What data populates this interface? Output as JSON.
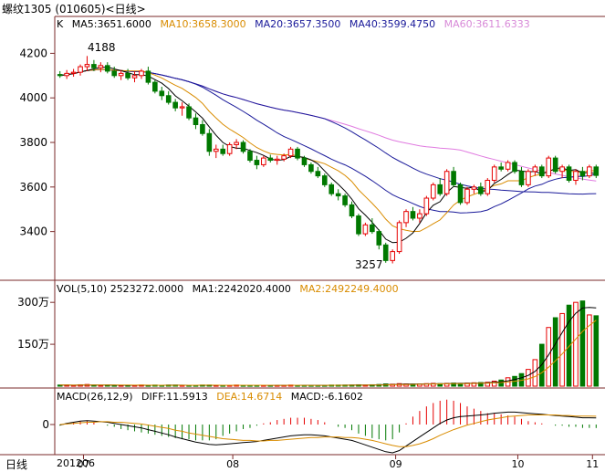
{
  "window": {
    "title": "螺纹1305 (010605)<日线>"
  },
  "price_panel": {
    "indicator": "K",
    "ma5": "MA5:3651.6000",
    "ma10": "MA10:3658.3000",
    "ma20": "MA20:3657.3500",
    "ma40": "MA40:3599.4750",
    "ma60": "MA60:3611.6333",
    "high_label": "4188",
    "low_label": "3257"
  },
  "volume_panel": {
    "vol": "VOL(5,10) 2523272.0000",
    "ma1": "MA1:2242020.4000",
    "ma2": "MA2:2492249.4000"
  },
  "macd_panel": {
    "macd": "MACD(26,12,9)",
    "diff": "DIFF:11.5913",
    "dea": "DEA:14.6714",
    "macd_val": "MACD:-6.1602"
  },
  "axis": {
    "period_label": "日线",
    "start_label": "201206"
  },
  "colors": {
    "up": "#e60000",
    "down": "#007800",
    "ma5": "#000000",
    "ma10": "#d98c00",
    "ma20": "#1a1a9a",
    "ma40": "#1a1a9a",
    "ma60": "#e07ae0"
  },
  "chart_data": {
    "type": "candlestick",
    "price_yaxis_ticks": [
      4200,
      4000,
      3800,
      3600,
      3400
    ],
    "price_ylim": [
      3210,
      4300
    ],
    "volume_yaxis_ticks": [
      "300万",
      "150万"
    ],
    "macd_yaxis_ticks": [
      "0"
    ],
    "x_month_labels": [
      "07",
      "08",
      "09",
      "10",
      "11"
    ],
    "ohlc": [
      [
        4105,
        4120,
        4090,
        4100
      ],
      [
        4100,
        4125,
        4085,
        4110
      ],
      [
        4110,
        4130,
        4095,
        4115
      ],
      [
        4115,
        4150,
        4100,
        4140
      ],
      [
        4140,
        4188,
        4120,
        4150
      ],
      [
        4150,
        4170,
        4120,
        4135
      ],
      [
        4135,
        4160,
        4115,
        4145
      ],
      [
        4145,
        4160,
        4110,
        4120
      ],
      [
        4120,
        4140,
        4090,
        4100
      ],
      [
        4100,
        4125,
        4080,
        4110
      ],
      [
        4110,
        4130,
        4080,
        4090
      ],
      [
        4090,
        4120,
        4070,
        4100
      ],
      [
        4100,
        4130,
        4085,
        4120
      ],
      [
        4120,
        4140,
        4060,
        4070
      ],
      [
        4070,
        4080,
        4020,
        4030
      ],
      [
        4030,
        4050,
        3990,
        4010
      ],
      [
        4010,
        4030,
        3970,
        3980
      ],
      [
        3980,
        3995,
        3940,
        3955
      ],
      [
        3955,
        3980,
        3920,
        3960
      ],
      [
        3960,
        3975,
        3900,
        3910
      ],
      [
        3910,
        3930,
        3860,
        3880
      ],
      [
        3880,
        3900,
        3830,
        3840
      ],
      [
        3840,
        3860,
        3740,
        3760
      ],
      [
        3760,
        3790,
        3730,
        3770
      ],
      [
        3770,
        3790,
        3740,
        3750
      ],
      [
        3750,
        3800,
        3740,
        3790
      ],
      [
        3790,
        3815,
        3770,
        3800
      ],
      [
        3800,
        3810,
        3750,
        3760
      ],
      [
        3760,
        3770,
        3710,
        3720
      ],
      [
        3720,
        3740,
        3680,
        3700
      ],
      [
        3700,
        3740,
        3690,
        3730
      ],
      [
        3730,
        3745,
        3710,
        3720
      ],
      [
        3720,
        3740,
        3700,
        3725
      ],
      [
        3725,
        3750,
        3715,
        3740
      ],
      [
        3740,
        3780,
        3730,
        3770
      ],
      [
        3770,
        3780,
        3720,
        3730
      ],
      [
        3730,
        3740,
        3690,
        3700
      ],
      [
        3700,
        3710,
        3660,
        3670
      ],
      [
        3670,
        3690,
        3640,
        3650
      ],
      [
        3650,
        3660,
        3600,
        3610
      ],
      [
        3610,
        3620,
        3560,
        3570
      ],
      [
        3570,
        3590,
        3540,
        3560
      ],
      [
        3560,
        3570,
        3510,
        3520
      ],
      [
        3520,
        3535,
        3460,
        3470
      ],
      [
        3470,
        3480,
        3380,
        3390
      ],
      [
        3390,
        3440,
        3380,
        3430
      ],
      [
        3430,
        3460,
        3390,
        3400
      ],
      [
        3400,
        3410,
        3320,
        3340
      ],
      [
        3340,
        3350,
        3260,
        3270
      ],
      [
        3270,
        3320,
        3257,
        3310
      ],
      [
        3310,
        3450,
        3300,
        3440
      ],
      [
        3440,
        3500,
        3420,
        3490
      ],
      [
        3490,
        3510,
        3450,
        3460
      ],
      [
        3460,
        3500,
        3440,
        3480
      ],
      [
        3480,
        3560,
        3470,
        3550
      ],
      [
        3550,
        3620,
        3540,
        3610
      ],
      [
        3610,
        3640,
        3560,
        3570
      ],
      [
        3570,
        3680,
        3560,
        3670
      ],
      [
        3670,
        3690,
        3600,
        3610
      ],
      [
        3610,
        3620,
        3520,
        3530
      ],
      [
        3530,
        3600,
        3520,
        3590
      ],
      [
        3590,
        3610,
        3570,
        3600
      ],
      [
        3600,
        3620,
        3560,
        3570
      ],
      [
        3570,
        3640,
        3560,
        3630
      ],
      [
        3630,
        3700,
        3620,
        3690
      ],
      [
        3690,
        3710,
        3670,
        3680
      ],
      [
        3680,
        3720,
        3670,
        3710
      ],
      [
        3710,
        3720,
        3660,
        3670
      ],
      [
        3670,
        3690,
        3600,
        3610
      ],
      [
        3610,
        3680,
        3600,
        3670
      ],
      [
        3670,
        3700,
        3650,
        3690
      ],
      [
        3690,
        3700,
        3640,
        3650
      ],
      [
        3650,
        3740,
        3640,
        3730
      ],
      [
        3730,
        3740,
        3660,
        3670
      ],
      [
        3670,
        3700,
        3640,
        3690
      ],
      [
        3690,
        3700,
        3620,
        3630
      ],
      [
        3630,
        3680,
        3610,
        3670
      ],
      [
        3670,
        3690,
        3630,
        3650
      ],
      [
        3650,
        3700,
        3640,
        3690
      ],
      [
        3690,
        3700,
        3640,
        3652
      ]
    ],
    "volume": [
      4,
      4,
      3,
      5,
      6,
      4,
      3,
      4,
      3,
      3,
      3,
      3,
      4,
      3,
      4,
      3,
      4,
      4,
      3,
      3,
      3,
      4,
      4,
      3,
      3,
      3,
      4,
      3,
      3,
      3,
      3,
      3,
      3,
      3,
      4,
      3,
      3,
      3,
      3,
      3,
      4,
      4,
      4,
      4,
      5,
      4,
      5,
      6,
      8,
      7,
      9,
      8,
      7,
      8,
      9,
      10,
      9,
      10,
      11,
      10,
      11,
      12,
      13,
      14,
      18,
      22,
      30,
      35,
      45,
      60,
      95,
      150,
      210,
      245,
      260,
      290,
      300,
      305,
      255,
      252
    ],
    "macd_diff": [
      -1,
      2,
      4,
      6,
      7,
      6,
      5,
      4,
      2,
      0,
      -2,
      -4,
      -6,
      -9,
      -12,
      -15,
      -18,
      -22,
      -25,
      -28,
      -31,
      -33,
      -35,
      -36,
      -35,
      -34,
      -33,
      -32,
      -31,
      -30,
      -28,
      -26,
      -24,
      -22,
      -20,
      -19,
      -18,
      -18,
      -19,
      -20,
      -22,
      -24,
      -26,
      -28,
      -32,
      -36,
      -40,
      -44,
      -48,
      -50,
      -46,
      -38,
      -30,
      -22,
      -14,
      -6,
      2,
      8,
      12,
      14,
      15,
      16,
      17,
      18,
      20,
      21,
      22,
      22,
      21,
      20,
      19,
      18,
      17,
      16,
      15,
      14,
      13,
      12,
      12,
      11.59
    ],
    "macd_dea": [
      0,
      1,
      2,
      3,
      4,
      4,
      5,
      5,
      4,
      4,
      3,
      2,
      1,
      -1,
      -3,
      -5,
      -7,
      -10,
      -12,
      -15,
      -17,
      -19,
      -21,
      -23,
      -25,
      -26,
      -27,
      -28,
      -28,
      -29,
      -29,
      -28,
      -28,
      -27,
      -26,
      -25,
      -24,
      -23,
      -23,
      -22,
      -22,
      -22,
      -23,
      -23,
      -24,
      -26,
      -28,
      -31,
      -34,
      -37,
      -39,
      -39,
      -37,
      -34,
      -30,
      -25,
      -19,
      -14,
      -9,
      -5,
      -1,
      2,
      5,
      8,
      10,
      12,
      14,
      15,
      16,
      17,
      17,
      17,
      17,
      17,
      16,
      16,
      15,
      15,
      15,
      14.67
    ]
  }
}
